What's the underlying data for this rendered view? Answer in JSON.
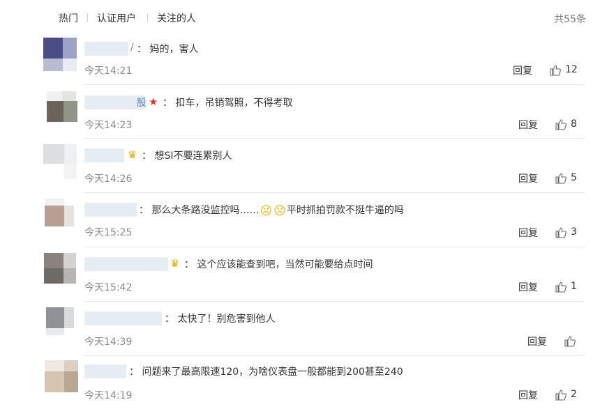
{
  "tabs": [
    "热门",
    "认证用户",
    "关注的人"
  ],
  "total_count": "共55条",
  "reply_label": "回复",
  "colors": {
    "username": "#5d84c1",
    "text": "#333333",
    "muted": "#8a8a8a",
    "divider": "#e6e6e6"
  },
  "comments": [
    {
      "name_fragment": "/",
      "badge": "",
      "text": "：  妈的，害人",
      "time": "今天14:21",
      "likes": "12"
    },
    {
      "name_fragment": "股",
      "badge": "star-icon",
      "text": "：  扣车，吊销驾照，不得考取",
      "time": "今天14:23",
      "likes": "8"
    },
    {
      "name_fragment": "",
      "badge": "crown-icon",
      "text": "：  想SI不要连累别人",
      "time": "今天14:26",
      "likes": "5"
    },
    {
      "name_fragment": "",
      "badge": "",
      "text_parts": [
        "：  那么大条路没监控吗……",
        "平时抓拍罚款不挺牛逼的吗"
      ],
      "time": "今天15:25",
      "likes": "3"
    },
    {
      "name_fragment": "",
      "badge": "crown-icon",
      "text": "：  这个应该能查到吧，当然可能要给点时间",
      "time": "今天15:42",
      "likes": "1"
    },
    {
      "name_fragment": "",
      "badge": "",
      "text": "：  太快了！别危害到他人",
      "time": "今天14:39",
      "likes": ""
    },
    {
      "name_fragment": "",
      "badge": "",
      "text": "：  问题来了最高限速120，为啥仪表盘一般都能到200甚至240",
      "time": "今天14:19",
      "likes": "2"
    }
  ]
}
